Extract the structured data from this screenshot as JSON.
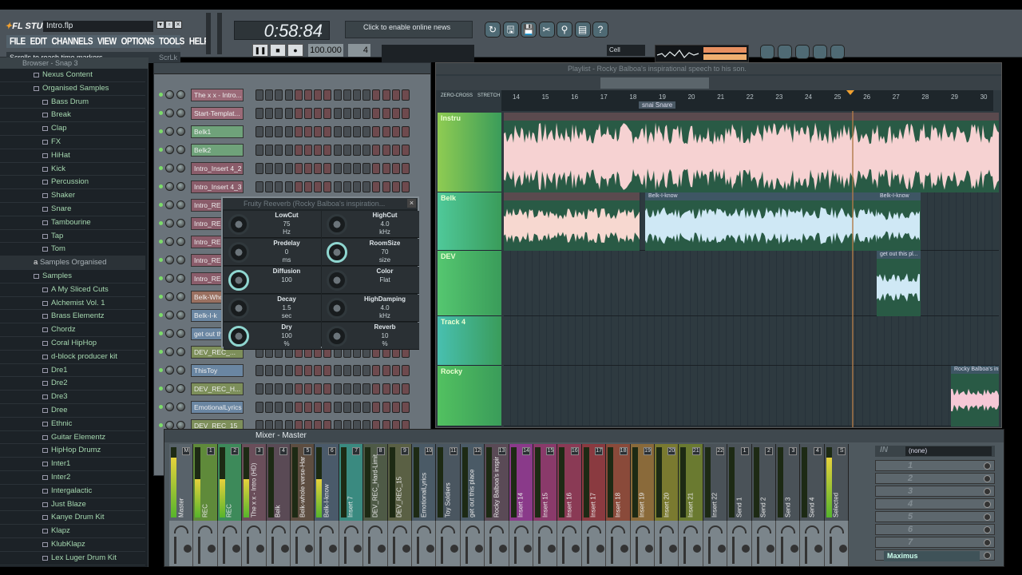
{
  "app": {
    "logo": "FL STUDIO",
    "project_title": "Intro.flp",
    "menu": [
      "FILE",
      "EDIT",
      "CHANNELS",
      "VIEW",
      "OPTIONS",
      "TOOLS",
      "HELP"
    ],
    "hint": "Scrolls to reach time markers",
    "hint_key": "ScrLk"
  },
  "transport": {
    "time": "0:58:84",
    "tempo": "100.000",
    "pattern": "4",
    "news": "Click to enable online news",
    "snap": "Cell",
    "buttons": [
      "pause",
      "stop",
      "record"
    ]
  },
  "toolbar_icons": [
    "undo-icon",
    "save-new-icon",
    "save-icon",
    "cut-icon",
    "search-icon",
    "document-icon",
    "help-icon"
  ],
  "view_icons": [
    "playlist-icon",
    "step-sequencer-icon",
    "piano-roll-icon",
    "browser-icon",
    "mixer-icon"
  ],
  "browser": {
    "title": "Browser - Snap 3",
    "items": [
      {
        "label": "Nexus Content",
        "level": 0
      },
      {
        "label": "Organised Samples",
        "level": 0
      },
      {
        "label": "Bass Drum",
        "level": 1
      },
      {
        "label": "Break",
        "level": 1
      },
      {
        "label": "Clap",
        "level": 1
      },
      {
        "label": "FX",
        "level": 1
      },
      {
        "label": "HiHat",
        "level": 1
      },
      {
        "label": "Kick",
        "level": 1
      },
      {
        "label": "Percussion",
        "level": 1
      },
      {
        "label": "Shaker",
        "level": 1
      },
      {
        "label": "Snare",
        "level": 1
      },
      {
        "label": "Tambourine",
        "level": 1
      },
      {
        "label": "Tap",
        "level": 1
      },
      {
        "label": "Tom",
        "level": 1
      },
      {
        "label": "Samples Organised",
        "level": 0,
        "selected": true
      },
      {
        "label": "Samples",
        "level": 0
      },
      {
        "label": "A My Sliced Cuts",
        "level": 1
      },
      {
        "label": "Alchemist Vol. 1",
        "level": 1
      },
      {
        "label": "Brass Elementz",
        "level": 1
      },
      {
        "label": "Chordz",
        "level": 1
      },
      {
        "label": "Coral HipHop",
        "level": 1
      },
      {
        "label": "d-block producer kit",
        "level": 1
      },
      {
        "label": "Dre1",
        "level": 1
      },
      {
        "label": "Dre2",
        "level": 1
      },
      {
        "label": "Dre3",
        "level": 1
      },
      {
        "label": "Dree",
        "level": 1
      },
      {
        "label": "Ethnic",
        "level": 1
      },
      {
        "label": "Guitar Elementz",
        "level": 1
      },
      {
        "label": "HipHop Drumz",
        "level": 1
      },
      {
        "label": "Inter1",
        "level": 1
      },
      {
        "label": "Inter2",
        "level": 1
      },
      {
        "label": "Intergalactic",
        "level": 1
      },
      {
        "label": "Just Blaze",
        "level": 1
      },
      {
        "label": "Kanye Drum Kit",
        "level": 1
      },
      {
        "label": "Klapz",
        "level": 1
      },
      {
        "label": "KlubKlapz",
        "level": 1
      },
      {
        "label": "Lex Luger Drum Kit",
        "level": 1
      }
    ]
  },
  "channels": [
    {
      "name": "The x x - Intro...",
      "color": "#9b6a78"
    },
    {
      "name": "Start-Templat...",
      "color": "#9b6a78"
    },
    {
      "name": "Belk1",
      "color": "#6fa27a"
    },
    {
      "name": "Belk2",
      "color": "#6fa27a"
    },
    {
      "name": "Intro_Insert 4_2",
      "color": "#8a5c6a"
    },
    {
      "name": "Intro_Insert 4_3",
      "color": "#8a5c6a"
    },
    {
      "name": "Intro_RE",
      "color": "#8a5c6a"
    },
    {
      "name": "Intro_RE",
      "color": "#8a5c6a"
    },
    {
      "name": "Intro_RE",
      "color": "#8a5c6a"
    },
    {
      "name": "Intro_RE",
      "color": "#8a5c6a"
    },
    {
      "name": "Intro_RE",
      "color": "#8a5c6a"
    },
    {
      "name": "Belk-Who",
      "color": "#9a7060"
    },
    {
      "name": "Belk-I-k",
      "color": "#6a86a2"
    },
    {
      "name": "get out thi",
      "color": "#6a86a2"
    },
    {
      "name": "DEV_REC_...",
      "color": "#7d8f5a"
    },
    {
      "name": "ThisToy",
      "color": "#6a86a2"
    },
    {
      "name": "DEV_REC_H...",
      "color": "#7d8f5a"
    },
    {
      "name": "EmotionalLyrics",
      "color": "#6a86a2"
    },
    {
      "name": "DEV_REC_15",
      "color": "#7d8f5a"
    }
  ],
  "reverb": {
    "title": "Fruity Reeverb (Rocky Balboa's inspiration...",
    "params": [
      {
        "label": "LowCut",
        "value": "75",
        "unit": "Hz",
        "active": false
      },
      {
        "label": "HighCut",
        "value": "4.0",
        "unit": "kHz",
        "active": false
      },
      {
        "label": "Predelay",
        "value": "0",
        "unit": "ms",
        "active": false
      },
      {
        "label": "RoomSize",
        "value": "70",
        "unit": "size",
        "active": true
      },
      {
        "label": "Diffusion",
        "value": "100",
        "unit": "",
        "active": true
      },
      {
        "label": "Color",
        "value": "Flat",
        "unit": "",
        "active": false
      },
      {
        "label": "Decay",
        "value": "1.5",
        "unit": "sec",
        "active": false
      },
      {
        "label": "HighDamping",
        "value": "4.0",
        "unit": "kHz",
        "active": false
      },
      {
        "label": "Dry",
        "value": "100",
        "unit": "%",
        "active": true
      },
      {
        "label": "Reverb",
        "value": "10",
        "unit": "%",
        "active": false
      }
    ]
  },
  "playlist": {
    "title": "Playlist - Rocky Balboa's inspirational speech to his son.",
    "ruler": [
      "14",
      "15",
      "16",
      "17",
      "18",
      "19",
      "20",
      "21",
      "22",
      "23",
      "24",
      "25",
      "26",
      "27",
      "28",
      "29",
      "30"
    ],
    "marker": "snai Snare",
    "snap_labels": [
      "ZERO-CROSS",
      "STRETCH"
    ],
    "tracks": [
      {
        "name": "Instru",
        "color": "#8fcc52"
      },
      {
        "name": "Belk",
        "color": "#4fc99a"
      },
      {
        "name": "DEV",
        "color": "#55c770"
      },
      {
        "name": "Track 4",
        "color": "#48c0b0"
      },
      {
        "name": "Rocky",
        "color": "#52c160"
      }
    ],
    "clips": [
      "Belk-I-know",
      "Belk-I-know",
      "get out this pl...",
      "Rocky Balboa's ins"
    ]
  },
  "mixer": {
    "title": "Mixer - Master",
    "strips": [
      {
        "no": "M",
        "name": "Master",
        "color": "#58626a"
      },
      {
        "no": "1",
        "name": "REC",
        "color": "#5f8a3a"
      },
      {
        "no": "2",
        "name": "REC",
        "color": "#3d8a5a"
      },
      {
        "no": "3",
        "name": "The x x - Intro (HD)",
        "color": "#6a4e5a"
      },
      {
        "no": "4",
        "name": "Belk",
        "color": "#5a4a55"
      },
      {
        "no": "5",
        "name": "Belk-whole verse-Har",
        "color": "#5d4d40"
      },
      {
        "no": "6",
        "name": "Belk-I-know",
        "color": "#4a5a6a"
      },
      {
        "no": "7",
        "name": "Insert 7",
        "color": "#3a8a80"
      },
      {
        "no": "8",
        "name": "DEV_REC_Hard-Limit",
        "color": "#4e5a46"
      },
      {
        "no": "9",
        "name": "DEV_REC_15",
        "color": "#5a6044"
      },
      {
        "no": "10",
        "name": "EmotionalLyrics",
        "color": "#4a5a66"
      },
      {
        "no": "11",
        "name": "Toy Soldiers",
        "color": "#4a5660"
      },
      {
        "no": "12",
        "name": "get out this place",
        "color": "#4a5a66"
      },
      {
        "no": "13",
        "name": "Rocky Balboa's inspir",
        "color": "#5a4a56"
      },
      {
        "no": "14",
        "name": "Insert 14",
        "color": "#8a3a8a"
      },
      {
        "no": "15",
        "name": "Insert 15",
        "color": "#8a3a6a"
      },
      {
        "no": "16",
        "name": "Insert 16",
        "color": "#8a3a55"
      },
      {
        "no": "17",
        "name": "Insert 17",
        "color": "#8a3a40"
      },
      {
        "no": "18",
        "name": "Insert 18",
        "color": "#8a4a3a"
      },
      {
        "no": "19",
        "name": "Insert 19",
        "color": "#8a6a3a"
      },
      {
        "no": "20",
        "name": "Insert 20",
        "color": "#7a7a30"
      },
      {
        "no": "21",
        "name": "Insert 21",
        "color": "#6a7a30"
      },
      {
        "no": "22",
        "name": "Insert 22",
        "color": "#4a5258"
      },
      {
        "no": "1",
        "name": "Send 1",
        "color": "#4a5258"
      },
      {
        "no": "2",
        "name": "Send 2",
        "color": "#4a5258"
      },
      {
        "no": "3",
        "name": "Send 3",
        "color": "#4a5258"
      },
      {
        "no": "4",
        "name": "Send 4",
        "color": "#4a5258"
      },
      {
        "no": "S",
        "name": "Selected",
        "color": "#4a5258"
      }
    ],
    "input_label": "IN",
    "input": "(none)",
    "fx_slots": [
      "1",
      "2",
      "3",
      "4",
      "5",
      "6",
      "7",
      "Maximus"
    ]
  }
}
